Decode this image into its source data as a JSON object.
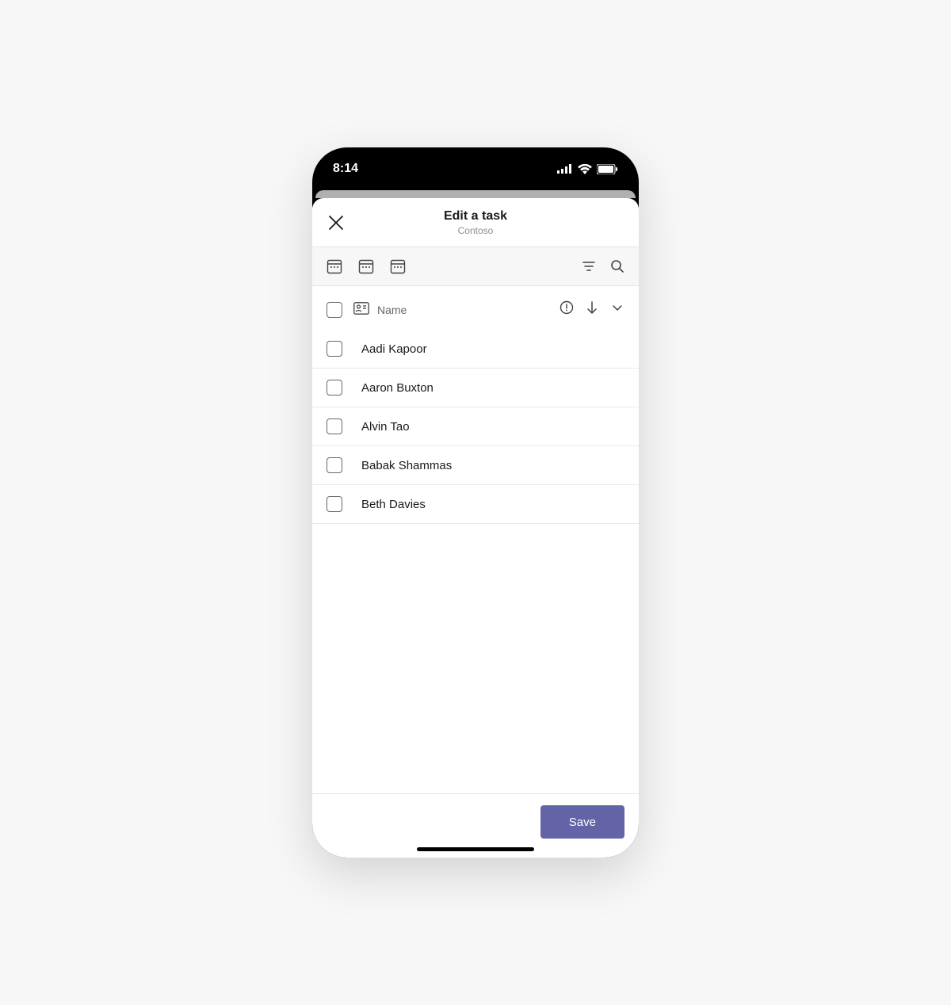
{
  "status": {
    "time": "8:14"
  },
  "nav": {
    "title": "Edit a task",
    "subtitle": "Contoso"
  },
  "header": {
    "column_label": "Name"
  },
  "people": [
    {
      "name": "Aadi Kapoor"
    },
    {
      "name": "Aaron Buxton"
    },
    {
      "name": "Alvin Tao"
    },
    {
      "name": "Babak Shammas"
    },
    {
      "name": "Beth Davies"
    }
  ],
  "footer": {
    "save_label": "Save"
  }
}
